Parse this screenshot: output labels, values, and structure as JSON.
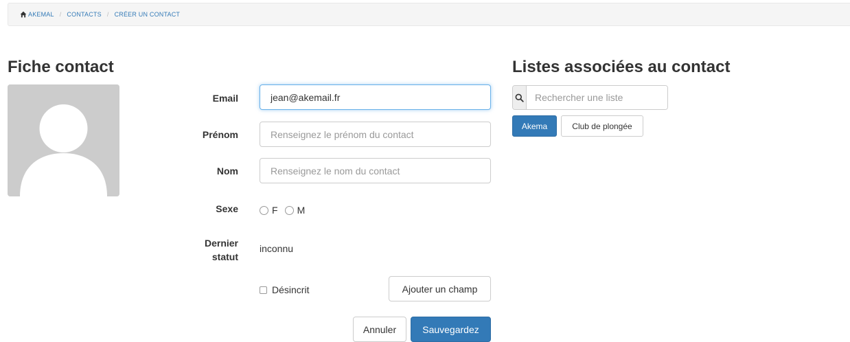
{
  "breadcrumb": {
    "items": [
      "AKEMAL",
      "CONTACTS",
      "CRÉER UN CONTACT"
    ],
    "separator": "/"
  },
  "left_panel": {
    "title": "Fiche contact"
  },
  "form": {
    "email": {
      "label": "Email",
      "value": "jean@akemail.fr",
      "placeholder": ""
    },
    "firstname": {
      "label": "Prénom",
      "value": "",
      "placeholder": "Renseignez le prénom du contact"
    },
    "lastname": {
      "label": "Nom",
      "value": "",
      "placeholder": "Renseignez le nom du contact"
    },
    "gender": {
      "label": "Sexe",
      "options": [
        "F",
        "M"
      ]
    },
    "last_status": {
      "label_line1": "Dernier",
      "label_line2": "statut",
      "value": "inconnu"
    },
    "unsubscribed": {
      "label": "Désincrit",
      "checked": false
    },
    "add_field_label": "Ajouter un champ",
    "cancel_label": "Annuler",
    "save_label": "Sauvegardez"
  },
  "right_panel": {
    "title": "Listes associées au contact",
    "search": {
      "placeholder": "Rechercher une liste"
    },
    "tags": [
      {
        "label": "Akema",
        "selected": true
      },
      {
        "label": "Club de plongée",
        "selected": false
      }
    ]
  },
  "colors": {
    "primary": "#337ab7",
    "breadcrumb_bg": "#f5f5f5",
    "avatar_bg": "#cccccc",
    "focus_border": "#66afe9"
  },
  "icons": {
    "breadcrumb_home": "home-icon",
    "search": "search-icon",
    "avatar": "user-silhouette-icon"
  }
}
